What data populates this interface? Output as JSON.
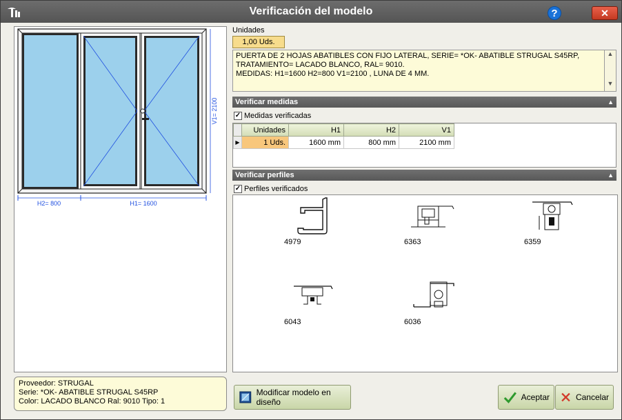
{
  "window": {
    "title": "Verificación del modelo",
    "help_label": "?",
    "close_label": "✕"
  },
  "drawing": {
    "h2_label": "H2= 800",
    "h1_label": "H1= 1600",
    "v1_label": "V1= 2100"
  },
  "info": {
    "lines": [
      "Proveedor: STRUGAL",
      "Serie: *OK- ABATIBLE STRUGAL S45RP",
      "Color: LACADO BLANCO  Ral: 9010  Tipo: 1"
    ]
  },
  "units": {
    "label": "Unidades",
    "value": "1,00 Uds."
  },
  "description": "PUERTA DE 2 HOJAS ABATIBLES CON FIJO LATERAL, SERIE= *OK- ABATIBLE STRUGAL S45RP,\nTRATAMIENTO=  LACADO BLANCO, RAL= 9010.\nMEDIDAS: H1=1600 H2=800 V1=2100  , LUNA DE 4 MM.",
  "measures": {
    "header": "Verificar medidas",
    "checkbox_label": "Medidas verificadas",
    "checked": true,
    "columns": [
      "Unidades",
      "H1",
      "H2",
      "V1"
    ],
    "rows": [
      [
        "1 Uds.",
        "1600 mm",
        "800 mm",
        "2100 mm"
      ]
    ]
  },
  "profiles_section": {
    "header": "Verificar perfiles",
    "checkbox_label": "Perfiles verificados",
    "checked": true,
    "items": [
      "4979",
      "6363",
      "6359",
      "6043",
      "6036"
    ]
  },
  "buttons": {
    "modify": "Modificar modelo en diseño",
    "accept": "Aceptar",
    "cancel": "Cancelar"
  },
  "colors": {
    "title_bar": "#5e5e5e",
    "glass": "#9cd0ec",
    "highlight": "#f8c77c",
    "button": "#d6e0bc"
  }
}
